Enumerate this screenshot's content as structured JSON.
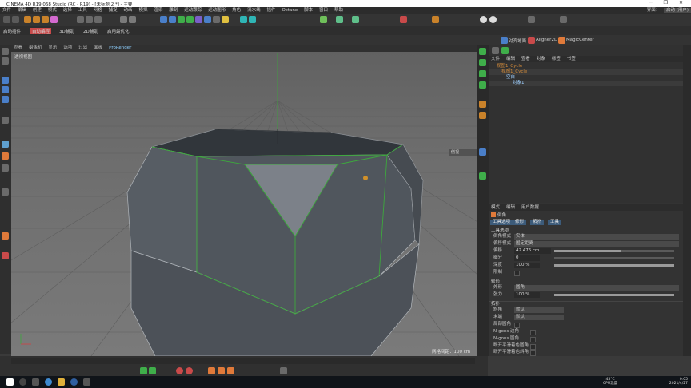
{
  "window": {
    "title": "CINEMA 4D R19.068 Studio (RC - R19) - [未标题 2 *] - 主要",
    "controls": "─ ❐ ✕"
  },
  "menubar": {
    "items": [
      "文件",
      "编辑",
      "创建",
      "模式",
      "选择",
      "工具",
      "网格",
      "捕捉",
      "动画",
      "模拟",
      "渲染",
      "雕刻",
      "运动跟踪",
      "运动图形",
      "角色",
      "流水线",
      "插件",
      "Octane",
      "脚本",
      "窗口",
      "帮助"
    ],
    "layout_label": "界面：",
    "layout_value": "启动 (用户)"
  },
  "toolbar2": {
    "tabs": [
      "启动插件",
      "自动编程",
      "3D辅助",
      "2D辅助",
      "启用最优化"
    ]
  },
  "viewport": {
    "menu": [
      "查看",
      "摄像机",
      "显示",
      "选项",
      "过滤",
      "面板"
    ],
    "prorender": "ProRender",
    "camera_label": "透视视图",
    "grid_spacing": "网格间距：100 cm",
    "dropdown": "侧视"
  },
  "objects": {
    "menu": [
      "文件",
      "编辑",
      "查看",
      "对象",
      "标签",
      "书签"
    ],
    "header_tabs": [
      "对齐地面",
      "Aligner2D",
      "MagicCenter"
    ],
    "tree": [
      {
        "name": "视图1_Cycle",
        "indent": 0,
        "color": "#d18a3a"
      },
      {
        "name": "视图1_Cycle",
        "indent": 1,
        "color": "#d18a3a"
      },
      {
        "name": "空白",
        "indent": 2,
        "color": "#9fd0ff"
      },
      {
        "name": "对象1",
        "indent": 3,
        "color": "#9fd0ff"
      }
    ]
  },
  "attributes": {
    "menu": [
      "模式",
      "编辑",
      "用户数据"
    ],
    "object_label": "倒角",
    "tabs": [
      "工具选项",
      "修形",
      "拓扑",
      "工具"
    ],
    "sections": {
      "tool": "工具选项",
      "shape": "修形",
      "topology": "拓扑"
    },
    "rows": {
      "bevel_mode": {
        "label": "倒角模式",
        "value": "实体"
      },
      "offset_mode": {
        "label": "偏移模式",
        "value": "固定距离"
      },
      "offset": {
        "label": "偏移",
        "value": "42.476 cm",
        "fraction": 0.55
      },
      "subdivision": {
        "label": "细分",
        "value": "0",
        "fraction": 0.0
      },
      "depth": {
        "label": "深度",
        "value": "100 %",
        "fraction": 1.0
      },
      "limit": {
        "label": "限制",
        "value": ""
      },
      "shape": {
        "label": "外形",
        "value": "圆角"
      },
      "tension": {
        "label": "张力",
        "value": "100 %",
        "fraction": 1.0
      },
      "miter": {
        "label": "斜角",
        "value": "默认"
      },
      "end": {
        "label": "末端",
        "value": "默认"
      },
      "partial": {
        "label": "局部圆角",
        "value": ""
      }
    },
    "checks": [
      "N-gons 边角",
      "N-gons 圆角",
      "断开平滑着色圆角",
      "断开平滑着色斜角"
    ]
  },
  "taskbar": {
    "cpu_temp": "45°C",
    "cpu_label": "CPU温度",
    "time": "0:05",
    "date": "2021/4/27"
  }
}
